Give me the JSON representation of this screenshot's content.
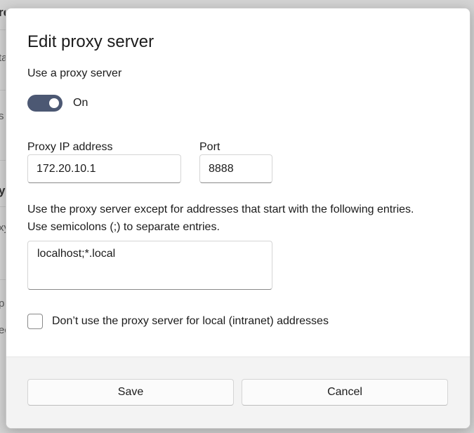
{
  "background": {
    "snippets": [
      "re",
      "ta",
      "s",
      "y",
      "xy",
      "p",
      "ec"
    ]
  },
  "dialog": {
    "title": "Edit proxy server",
    "use_proxy_label": "Use a proxy server",
    "toggle_state": "On",
    "toggle_on": true,
    "ip_label": "Proxy IP address",
    "ip_value": "172.20.10.1",
    "port_label": "Port",
    "port_value": "8888",
    "exceptions_description_line1": "Use the proxy server except for addresses that start with the following entries.",
    "exceptions_description_line2": "Use semicolons (;) to separate entries.",
    "exceptions_value": "localhost;*.local",
    "local_bypass_label": "Don’t use the proxy server for local (intranet) addresses",
    "local_bypass_checked": false
  },
  "buttons": {
    "save": "Save",
    "cancel": "Cancel"
  },
  "colors": {
    "toggle_on": "#4c5873",
    "footer": "#f3f3f3"
  }
}
